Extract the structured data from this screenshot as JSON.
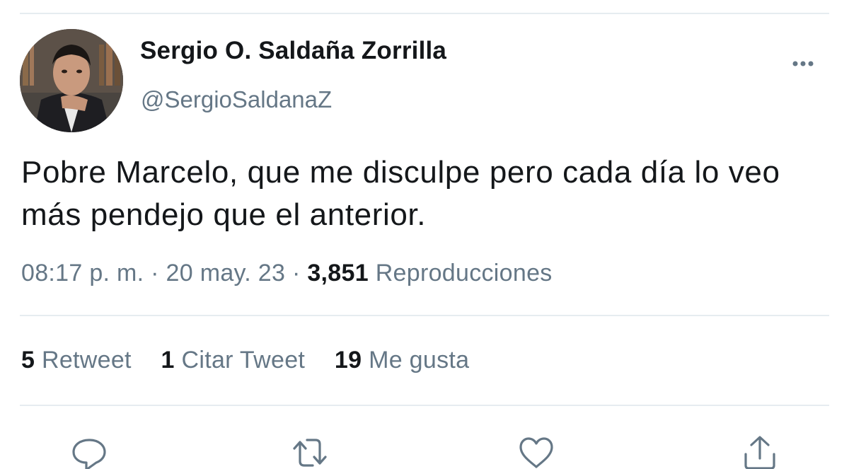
{
  "tweet": {
    "author": {
      "display_name": "Sergio O. Saldaña Zorrilla",
      "handle": "@SergioSaldanaZ"
    },
    "text": "Pobre Marcelo, que me disculpe pero cada día lo veo más pendejo que el anterior.",
    "meta": {
      "time": "08:17 p. m.",
      "separator": "·",
      "date": "20 may. 23",
      "views_count": "3,851",
      "views_label": "Reproducciones"
    },
    "stats": {
      "retweets_count": "5",
      "retweets_label": "Retweet",
      "quotes_count": "1",
      "quotes_label": "Citar Tweet",
      "likes_count": "19",
      "likes_label": "Me gusta"
    }
  },
  "icons": {
    "more": "more-horizontal-icon",
    "reply": "reply-icon",
    "retweet": "retweet-icon",
    "like": "heart-icon",
    "share": "share-icon"
  },
  "colors": {
    "text_primary": "#14171a",
    "text_secondary": "#657786",
    "divider": "#e6ecf0",
    "background": "#ffffff"
  }
}
